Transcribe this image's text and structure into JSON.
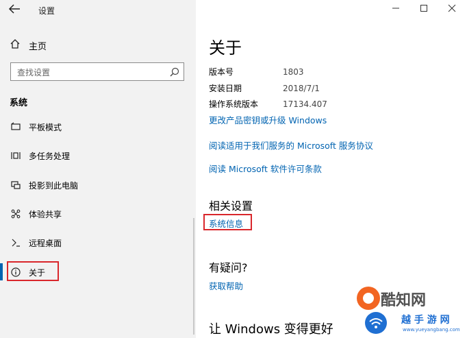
{
  "window": {
    "title": "设置"
  },
  "sidebar": {
    "home_label": "主页",
    "search_placeholder": "查找设置",
    "section_title": "系统",
    "items": [
      {
        "label": "平板模式",
        "icon": "tablet-mode-icon"
      },
      {
        "label": "多任务处理",
        "icon": "multitasking-icon"
      },
      {
        "label": "投影到此电脑",
        "icon": "project-icon"
      },
      {
        "label": "体验共享",
        "icon": "shared-experiences-icon"
      },
      {
        "label": "远程桌面",
        "icon": "remote-desktop-icon"
      },
      {
        "label": "关于",
        "icon": "info-icon",
        "selected": true
      }
    ]
  },
  "main": {
    "title": "关于",
    "specs": [
      {
        "key": "版本号",
        "value": "1803"
      },
      {
        "key": "安装日期",
        "value": "2018/7/1"
      },
      {
        "key": "操作系统版本",
        "value": "17134.407"
      }
    ],
    "links": [
      "更改产品密钥或升级 Windows",
      "阅读适用于我们服务的 Microsoft 服务协议",
      "阅读 Microsoft 软件许可条款"
    ],
    "related_settings_title": "相关设置",
    "system_info_link": "系统信息",
    "questions_title": "有疑问?",
    "get_help_link": "获取帮助",
    "bottom_title": "让 Windows 变得更好"
  },
  "watermark": {
    "logo_text": "酷知网",
    "sub_text": "越 手 游 网",
    "url": "www.yueyangbang.com"
  },
  "colors": {
    "accent": "#0063b1",
    "highlight_box": "#d9262b"
  }
}
